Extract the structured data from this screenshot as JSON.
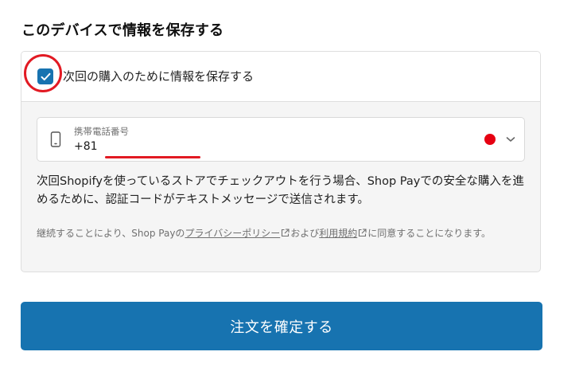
{
  "section": {
    "title": "このデバイスで情報を保存する"
  },
  "save_option": {
    "checked": true,
    "label": "次回の購入のために情報を保存する"
  },
  "phone": {
    "label": "携帯電話番号",
    "value": "+81",
    "country_flag_color": "#e60012"
  },
  "info": {
    "text": "次回Shopifyを使っているストアでチェックアウトを行う場合、Shop Payでの安全な購入を進めるために、認証コードがテキストメッセージで送信されます。"
  },
  "legal": {
    "prefix": "継続することにより、Shop Payの",
    "privacy_link": "プライバシーポリシー",
    "middle": "および",
    "terms_link": "利用規約",
    "suffix": "に同意することになります。"
  },
  "submit": {
    "label": "注文を確定する"
  },
  "colors": {
    "accent": "#1773b0",
    "annotation": "#e21a23"
  },
  "icons": {
    "checkbox": "checkmark-icon",
    "phone": "mobile-phone-icon",
    "dropdown": "chevron-down-icon",
    "external": "external-link-icon"
  }
}
